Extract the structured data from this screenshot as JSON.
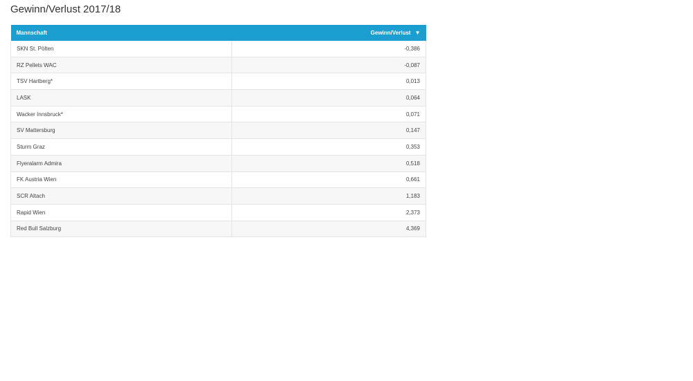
{
  "page": {
    "title": "Gewinn/Verlust 2017/18"
  },
  "colors": {
    "header_bg": "#1a9fd0",
    "header_text": "#ffffff",
    "row_alt": "#f7f7f7",
    "border": "#e4e4e4"
  },
  "icons": {
    "sort": "sort-desc-triangle-icon"
  },
  "chart_data": {
    "type": "table",
    "title": "Gewinn/Verlust 2017/18",
    "columns": [
      "Mannschaft",
      "Gewinn/Verlust"
    ],
    "rows": [
      {
        "team": "SKN St. Pölten",
        "value": "-0,386"
      },
      {
        "team": "RZ Pellets WAC",
        "value": "-0,087"
      },
      {
        "team": "TSV Hartberg*",
        "value": "0,013"
      },
      {
        "team": "LASK",
        "value": "0,064"
      },
      {
        "team": "Wacker Innsbruck*",
        "value": "0,071"
      },
      {
        "team": "SV Mattersburg",
        "value": "0,147"
      },
      {
        "team": "Sturm Graz",
        "value": "0,353"
      },
      {
        "team": "Flyeralarm Admira",
        "value": "0,518"
      },
      {
        "team": "FK Austria Wien",
        "value": "0,661"
      },
      {
        "team": "SCR Altach",
        "value": "1,183"
      },
      {
        "team": "Rapid Wien",
        "value": "2,373"
      },
      {
        "team": "Red Bull Salzburg",
        "value": "4,369"
      }
    ]
  }
}
